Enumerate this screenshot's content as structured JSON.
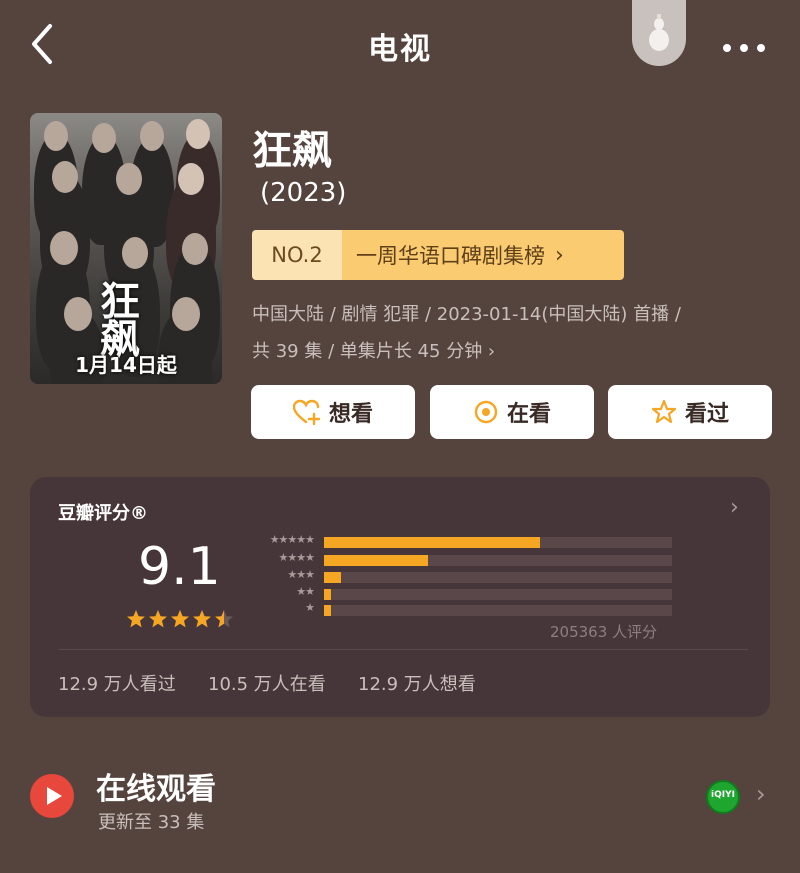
{
  "header": {
    "title": "电视",
    "back_icon": "chevron-left-icon",
    "gourd_icon": "gourd-icon",
    "more_icon": "more-horizontal-icon"
  },
  "show": {
    "title": "狂飙",
    "year": "(2023)",
    "poster": {
      "title": "狂飙",
      "date": "1月14日起"
    },
    "rank": {
      "number": "NO.2",
      "label": "一周华语口碑剧集榜",
      "chevron": "›"
    },
    "meta_line1": "中国大陆 / 剧情 犯罪 / 2023-01-14(中国大陆) 首播 /",
    "meta_line2": "共 39 集 / 单集片长 45 分钟 ›"
  },
  "actions": [
    {
      "label": "想看",
      "icon": "heart-plus-icon"
    },
    {
      "label": "在看",
      "icon": "target-circle-icon"
    },
    {
      "label": "看过",
      "icon": "star-outline-icon"
    }
  ],
  "rating": {
    "header": "豆瓣评分®",
    "chevron": "›",
    "score": "9.1",
    "score_stars": 4.5,
    "distribution": [
      {
        "stars": "★★★★★",
        "fraction": 0.62
      },
      {
        "stars": "★★★★",
        "fraction": 0.3
      },
      {
        "stars": "★★★",
        "fraction": 0.05
      },
      {
        "stars": "★★",
        "fraction": 0.02
      },
      {
        "stars": "★",
        "fraction": 0.02
      }
    ],
    "count": "205363 人评分",
    "stats": [
      "12.9 万人看过",
      "10.5 万人在看",
      "12.9 万人想看"
    ]
  },
  "watch": {
    "title": "在线观看",
    "subtitle": "更新至 33 集",
    "platform_icon": "iqiyi-icon",
    "platform_logo_text": "iQIYI",
    "chevron": "›"
  },
  "colors": {
    "background": "#55433e",
    "card": "#46363a",
    "accent": "#f5a623",
    "rank_bg": "#fbcb72",
    "play": "#e8473c"
  }
}
